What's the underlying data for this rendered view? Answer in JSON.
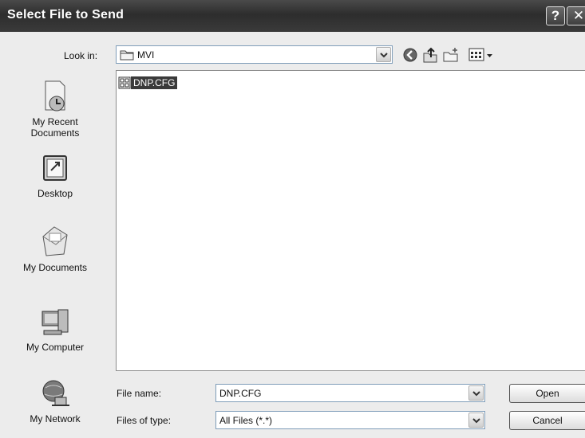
{
  "window": {
    "title": "Select File to Send",
    "help_glyph": "?",
    "close_glyph": "✕"
  },
  "lookin": {
    "label": "Look in:",
    "value": "MVI"
  },
  "toolbar": {
    "icons": [
      "back-icon",
      "up-folder-icon",
      "new-folder-icon",
      "view-menu-icon"
    ]
  },
  "places": [
    {
      "label": "My Recent\nDocuments",
      "icon": "recent-documents-icon"
    },
    {
      "label": "Desktop",
      "icon": "desktop-icon"
    },
    {
      "label": "My Documents",
      "icon": "my-documents-icon"
    },
    {
      "label": "My Computer",
      "icon": "my-computer-icon"
    },
    {
      "label": "My Network",
      "icon": "my-network-icon"
    }
  ],
  "files": [
    {
      "name": "DNP.CFG",
      "selected": true
    }
  ],
  "filename": {
    "label": "File name:",
    "value": "DNP.CFG"
  },
  "filetype": {
    "label": "Files of type:",
    "value": "All Files (*.*)"
  },
  "buttons": {
    "open": "Open",
    "cancel": "Cancel"
  }
}
